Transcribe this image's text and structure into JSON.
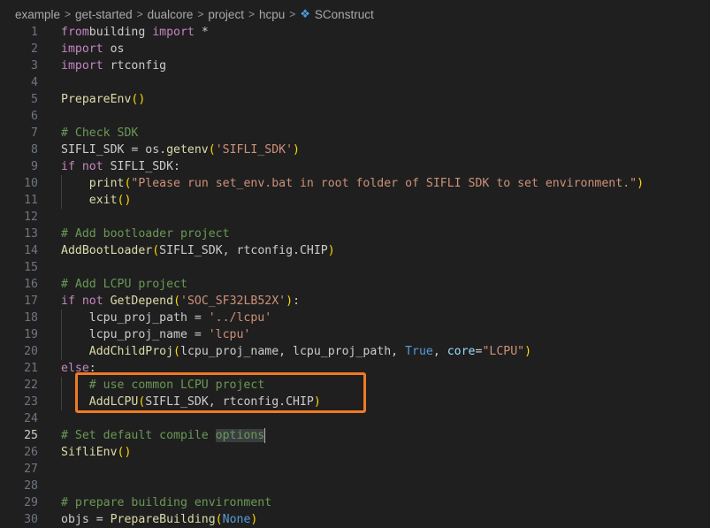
{
  "breadcrumb": {
    "items": [
      "example",
      "get-started",
      "dualcore",
      "project",
      "hcpu"
    ],
    "file": "SConstruct",
    "separator": ">"
  },
  "editor": {
    "active_line": 25,
    "lines": [
      {
        "n": "1",
        "t": [
          [
            "kw",
            "from"
          ],
          [
            "",
            "building "
          ],
          [
            "kw",
            "import"
          ],
          [
            "",
            " *"
          ]
        ]
      },
      {
        "n": "2",
        "t": [
          [
            "kw",
            "import"
          ],
          [
            "",
            " os"
          ]
        ]
      },
      {
        "n": "3",
        "t": [
          [
            "kw",
            "import"
          ],
          [
            "",
            " rtconfig"
          ]
        ]
      },
      {
        "n": "4",
        "t": []
      },
      {
        "n": "5",
        "t": [
          [
            "fn",
            "PrepareEnv"
          ],
          [
            "p1",
            "()"
          ]
        ]
      },
      {
        "n": "6",
        "t": []
      },
      {
        "n": "7",
        "t": [
          [
            "cm",
            "# Check SDK"
          ]
        ]
      },
      {
        "n": "8",
        "t": [
          [
            "",
            "SIFLI_SDK = os."
          ],
          [
            "fn",
            "getenv"
          ],
          [
            "p1",
            "("
          ],
          [
            "str",
            "'SIFLI_SDK'"
          ],
          [
            "p1",
            ")"
          ]
        ]
      },
      {
        "n": "9",
        "t": [
          [
            "kw",
            "if"
          ],
          [
            "kw",
            " not"
          ],
          [
            "",
            " SIFLI_SDK:"
          ]
        ]
      },
      {
        "n": "10",
        "t": [
          [
            "",
            "    "
          ],
          [
            "fn",
            "print"
          ],
          [
            "p1",
            "("
          ],
          [
            "str",
            "\"Please run set_env.bat in root folder of SIFLI SDK to set environment.\""
          ],
          [
            "p1",
            ")"
          ]
        ]
      },
      {
        "n": "11",
        "t": [
          [
            "",
            "    "
          ],
          [
            "fn",
            "exit"
          ],
          [
            "p1",
            "()"
          ]
        ]
      },
      {
        "n": "12",
        "t": []
      },
      {
        "n": "13",
        "t": [
          [
            "cm",
            "# Add bootloader project"
          ]
        ]
      },
      {
        "n": "14",
        "t": [
          [
            "fn",
            "AddBootLoader"
          ],
          [
            "p1",
            "("
          ],
          [
            "",
            "SIFLI_SDK, rtconfig.CHIP"
          ],
          [
            "p1",
            ")"
          ]
        ]
      },
      {
        "n": "15",
        "t": []
      },
      {
        "n": "16",
        "t": [
          [
            "cm",
            "# Add LCPU project"
          ]
        ]
      },
      {
        "n": "17",
        "t": [
          [
            "kw",
            "if"
          ],
          [
            "kw",
            " not"
          ],
          [
            "",
            " "
          ],
          [
            "fn",
            "GetDepend"
          ],
          [
            "p1",
            "("
          ],
          [
            "str",
            "'SOC_SF32LB52X'"
          ],
          [
            "p1",
            ")"
          ],
          [
            "",
            ":"
          ]
        ]
      },
      {
        "n": "18",
        "t": [
          [
            "",
            "    lcpu_proj_path = "
          ],
          [
            "str",
            "'../lcpu'"
          ]
        ]
      },
      {
        "n": "19",
        "t": [
          [
            "",
            "    lcpu_proj_name = "
          ],
          [
            "str",
            "'lcpu'"
          ]
        ]
      },
      {
        "n": "20",
        "t": [
          [
            "",
            "    "
          ],
          [
            "fn",
            "AddChildProj"
          ],
          [
            "p1",
            "("
          ],
          [
            "",
            "lcpu_proj_name, lcpu_proj_path, "
          ],
          [
            "const",
            "True"
          ],
          [
            "",
            ", "
          ],
          [
            "var",
            "core"
          ],
          [
            "",
            "="
          ],
          [
            "str",
            "\"LCPU\""
          ],
          [
            "p1",
            ")"
          ]
        ]
      },
      {
        "n": "21",
        "t": [
          [
            "kw",
            "else"
          ],
          [
            "",
            ":"
          ]
        ]
      },
      {
        "n": "22",
        "t": [
          [
            "",
            "    "
          ],
          [
            "cm",
            "# use common LCPU project"
          ]
        ]
      },
      {
        "n": "23",
        "t": [
          [
            "",
            "    "
          ],
          [
            "fn",
            "AddLCPU"
          ],
          [
            "p1",
            "("
          ],
          [
            "",
            "SIFLI_SDK, rtconfig.CHIP"
          ],
          [
            "p1",
            ")"
          ]
        ]
      },
      {
        "n": "24",
        "t": []
      },
      {
        "n": "25",
        "t": [
          [
            "cm",
            "# Set default compile "
          ],
          [
            "cmhl",
            "options"
          ]
        ]
      },
      {
        "n": "26",
        "t": [
          [
            "fn",
            "SifliEnv"
          ],
          [
            "p1",
            "()"
          ]
        ]
      },
      {
        "n": "27",
        "t": []
      },
      {
        "n": "28",
        "t": []
      },
      {
        "n": "29",
        "t": [
          [
            "cm",
            "# prepare building environment"
          ]
        ]
      },
      {
        "n": "30",
        "t": [
          [
            "",
            "objs = "
          ],
          [
            "fn",
            "PrepareBuilding"
          ],
          [
            "p1",
            "("
          ],
          [
            "const",
            "None"
          ],
          [
            "p1",
            ")"
          ]
        ]
      }
    ]
  },
  "annotation": {
    "box_color": "#f07a22",
    "covers_lines": [
      22,
      23
    ]
  },
  "colors": {
    "background": "#1f1f1f",
    "keyword": "#c586c0",
    "function": "#dcdcaa",
    "string": "#ce9178",
    "comment": "#6a9955",
    "constant": "#569cd6"
  },
  "icons": {
    "file_icon": "python-file-icon",
    "separator_icon": "chevron-right-icon"
  }
}
